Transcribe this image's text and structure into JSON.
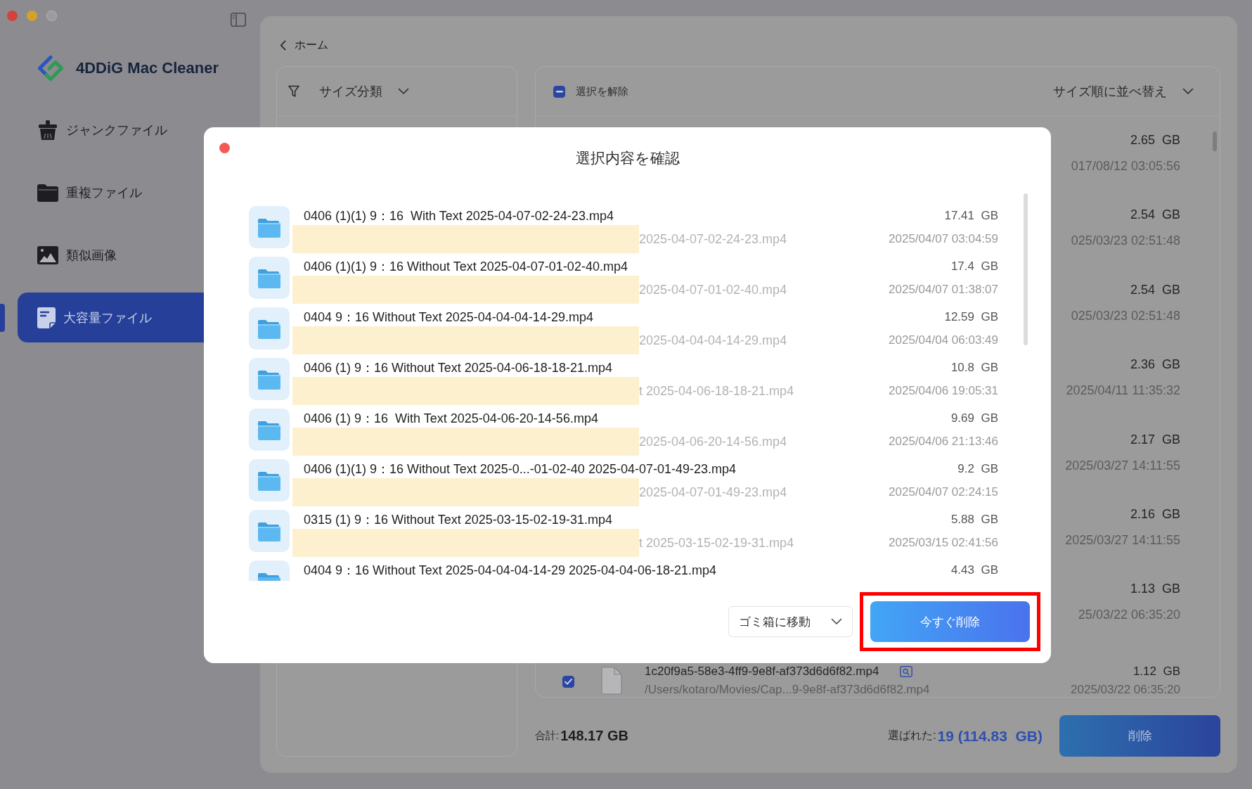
{
  "window": {
    "controls": [
      {
        "kind": "close",
        "disabled": false
      },
      {
        "kind": "minimize",
        "disabled": false
      },
      {
        "kind": "zoom",
        "disabled": true
      }
    ]
  },
  "app": {
    "name": "4DDiG Mac Cleaner"
  },
  "sidebar": {
    "items": [
      {
        "label": "ジャンクファイル",
        "kind": "junk",
        "selected": false
      },
      {
        "label": "重複ファイル",
        "kind": "duplicate",
        "selected": false
      },
      {
        "label": "類似画像",
        "kind": "image",
        "selected": false
      },
      {
        "label": "大容量ファイル",
        "kind": "large",
        "selected": true
      }
    ]
  },
  "main": {
    "back_link": "ホーム",
    "filter": {
      "label": "サイズ分類"
    },
    "list": {
      "select_all": {
        "label": "選択を解除",
        "indeterminate": true
      },
      "sort": "サイズ順に並べ替え",
      "covered_rows": [
        {
          "size": "2.65  GB",
          "date": "017/08/12 03:05:56"
        },
        {
          "size": "2.54  GB",
          "date": "025/03/23 02:51:48"
        },
        {
          "size": "2.54  GB",
          "date": "025/03/23 02:51:48"
        },
        {
          "size": "2.36  GB",
          "date": "2025/04/11 11:35:32"
        },
        {
          "size": "2.17  GB",
          "date": "2025/03/27 14:11:55"
        },
        {
          "size": "2.16  GB",
          "date": "2025/03/27 14:11:55"
        },
        {
          "size": "1.13  GB",
          "date": "25/03/22 06:35:20"
        }
      ],
      "rows": [
        {
          "checked": true,
          "name": "1c20f9a5-58e3-4ff9-9e8f-af373d6d6f82.mp4",
          "path": "/Users/kotaro/Movies/Cap...9-9e8f-af373d6d6f82.mp4",
          "size": "1.12  GB",
          "date": "2025/03/22 06:35:20"
        }
      ]
    },
    "footer": {
      "total_label": "合計:",
      "total": "148.17 GB",
      "selected_label": "選ばれた:",
      "selected": "19 (114.83  GB)",
      "delete_button": "削除"
    }
  },
  "dialog": {
    "title": "選択内容を確認",
    "rows": [
      {
        "name": "0406 (1)(1) 9：16  With Text 2025-04-07-02-24-23.mp4",
        "redacted": true,
        "path": "2025-04-07-02-24-23.mp4",
        "size": "17.41  GB",
        "date": "2025/04/07 03:04:59"
      },
      {
        "name": "0406 (1)(1) 9：16 Without Text 2025-04-07-01-02-40.mp4",
        "redacted": true,
        "path": "2025-04-07-01-02-40.mp4",
        "size": "17.4  GB",
        "date": "2025/04/07 01:38:07"
      },
      {
        "name": "0404 9：16 Without Text 2025-04-04-04-14-29.mp4",
        "redacted": true,
        "path": "2025-04-04-04-14-29.mp4",
        "size": "12.59  GB",
        "date": "2025/04/04 06:03:49"
      },
      {
        "name": "0406 (1) 9：16 Without Text 2025-04-06-18-18-21.mp4",
        "redacted": true,
        "path": "t 2025-04-06-18-18-21.mp4",
        "size": "10.8  GB",
        "date": "2025/04/06 19:05:31"
      },
      {
        "name": "0406 (1) 9：16  With Text 2025-04-06-20-14-56.mp4",
        "redacted": true,
        "path": "2025-04-06-20-14-56.mp4",
        "size": "9.69  GB",
        "date": "2025/04/06 21:13:46"
      },
      {
        "name": "0406 (1)(1) 9：16 Without Text 2025-0...-01-02-40 2025-04-07-01-49-23.mp4",
        "redacted": true,
        "path": "2025-04-07-01-49-23.mp4",
        "size": "9.2  GB",
        "date": "2025/04/07 02:24:15"
      },
      {
        "name": "0315 (1) 9：16 Without Text 2025-03-15-02-19-31.mp4",
        "redacted": true,
        "path": "t 2025-03-15-02-19-31.mp4",
        "size": "5.88  GB",
        "date": "2025/03/15 02:41:56"
      }
    ],
    "cut_row": {
      "name": "0404 9：16 Without Text 2025-04-04-04-14-29 2025-04-04-06-18-21.mp4",
      "size": "4.43  GB"
    },
    "move_option": "ゴミ箱に移動",
    "confirm_button": {
      "label": "今すぐ削除",
      "highlighted": true
    }
  }
}
